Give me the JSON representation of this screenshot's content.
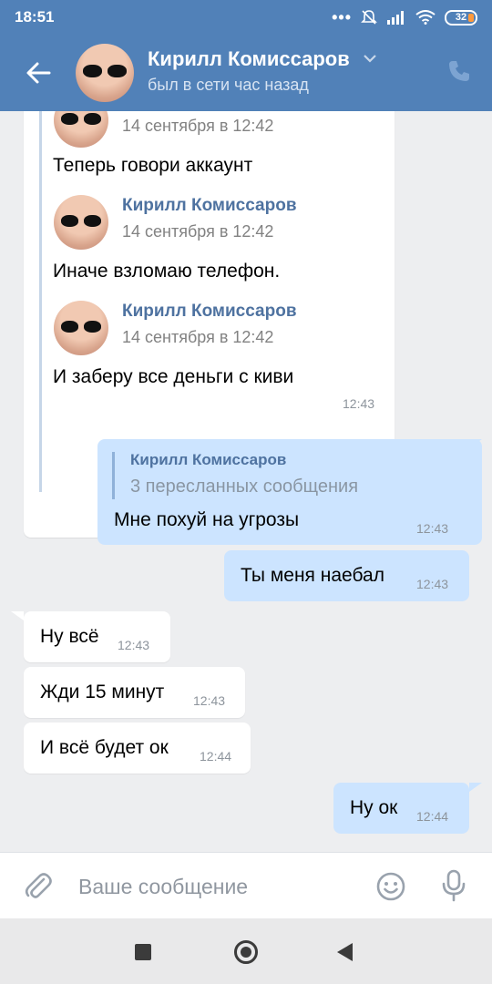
{
  "status_bar": {
    "time": "18:51",
    "battery": "32"
  },
  "header": {
    "name": "Кирилл Комиссаров",
    "status": "был в сети час назад"
  },
  "forwarded_block": {
    "items": [
      {
        "author": "",
        "date": "14 сентября в 12:42",
        "text": "Теперь говори аккаунт"
      },
      {
        "author": "Кирилл Комиссаров",
        "date": "14 сентября в 12:42",
        "text": "Иначе взломаю телефон."
      },
      {
        "author": "Кирилл Комиссаров",
        "date": "14 сентября в 12:42",
        "text": "И заберу все деньги с киви"
      }
    ],
    "time": "12:43"
  },
  "out_forward": {
    "author": "Кирилл Комиссаров",
    "summary": "3 пересланных сообщения",
    "text": "Мне похуй на угрозы",
    "time": "12:43"
  },
  "messages": [
    {
      "text": "Ты меня наебал",
      "time": "12:43",
      "dir": "out"
    },
    {
      "text": "Ну всё",
      "time": "12:43",
      "dir": "in"
    },
    {
      "text": "Жди 15 минут",
      "time": "12:43",
      "dir": "in"
    },
    {
      "text": "И всё будет ок",
      "time": "12:44",
      "dir": "in"
    },
    {
      "text": "Ну ок",
      "time": "12:44",
      "dir": "out"
    }
  ],
  "input": {
    "placeholder": "Ваше сообщение"
  },
  "colors": {
    "header_bg": "#5181b8",
    "out_bubble": "#cce4ff",
    "link": "#4e72a0"
  }
}
